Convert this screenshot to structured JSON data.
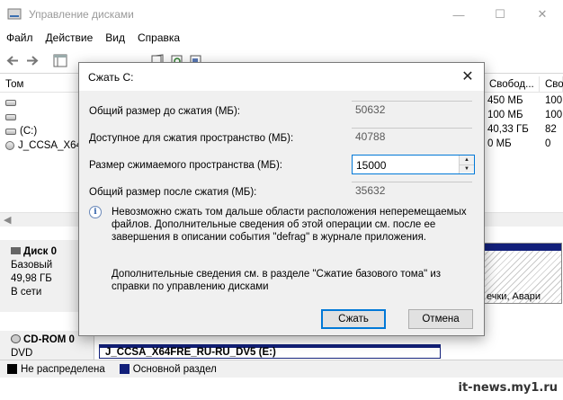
{
  "window": {
    "title": "Управление дисками",
    "minimize_glyph": "—",
    "maximize_glyph": "☐",
    "close_glyph": "✕"
  },
  "menu": [
    "Файл",
    "Действие",
    "Вид",
    "Справка"
  ],
  "volume_list": {
    "columns": {
      "volume": "Том",
      "free": "Свобод...",
      "percent": "Сво"
    },
    "rows": [
      {
        "name": "",
        "free": "450 МБ",
        "percent": "100"
      },
      {
        "name": "",
        "free": "100 МБ",
        "percent": "100"
      },
      {
        "name": "(C:)",
        "free": "40,33 ГБ",
        "percent": "82"
      },
      {
        "name": "J_CCSA_X64",
        "free": "0 МБ",
        "percent": "0"
      }
    ]
  },
  "disks": {
    "disk0": {
      "name": "Диск 0",
      "type": "Базовый",
      "size": "49,98 ГБ",
      "status": "В сети",
      "right_partition_text": "ечки, Авари"
    },
    "cdrom": {
      "name": "CD-ROM 0",
      "type": "DVD",
      "volume_label": "J_CCSA_X64FRE_RU-RU_DV5 (E:)"
    }
  },
  "legend": {
    "unallocated": "Не распределена",
    "primary": "Основной раздел",
    "unallocated_color": "#000000",
    "primary_color": "#12207a"
  },
  "dialog": {
    "title": "Сжать C:",
    "fields": {
      "total_before_label": "Общий размер до сжатия (МБ):",
      "total_before_value": "50632",
      "available_label": "Доступное для сжатия пространство (МБ):",
      "available_value": "40788",
      "shrink_label": "Размер сжимаемого пространства (МБ):",
      "shrink_value": "15000",
      "total_after_label": "Общий размер после сжатия (МБ):",
      "total_after_value": "35632"
    },
    "info_text": "Невозможно сжать том дальше области расположения неперемещаемых файлов. Дополнительные сведения об этой операции см. после ее завершения в описании события \"defrag\" в журнале приложения.",
    "more_text": "Дополнительные сведения см. в разделе \"Сжатие базового тома\" из справки по управлению дисками",
    "shrink_button": "Сжать",
    "cancel_button": "Отмена",
    "close_glyph": "✕"
  },
  "watermark": "it-news.my1.ru"
}
